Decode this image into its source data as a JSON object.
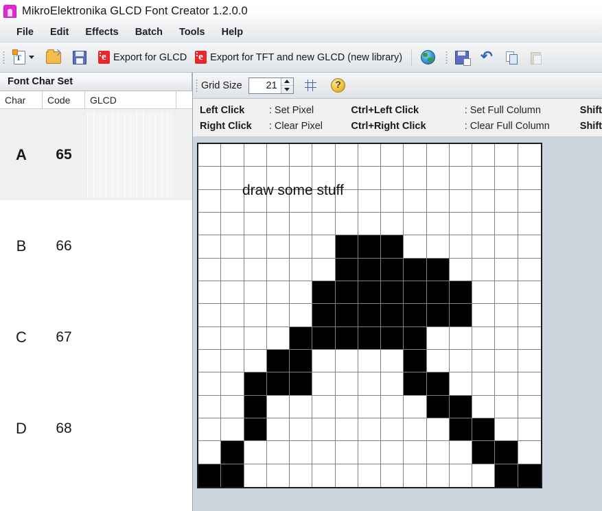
{
  "window": {
    "title": "MikroElektronika GLCD Font Creator 1.2.0.0",
    "icon": "app-icon"
  },
  "menubar": {
    "items": [
      {
        "label": "File"
      },
      {
        "label": "Edit"
      },
      {
        "label": "Effects"
      },
      {
        "label": "Batch"
      },
      {
        "label": "Tools"
      },
      {
        "label": "Help"
      }
    ]
  },
  "toolbar": {
    "new_label": "",
    "open_label": "",
    "save_label": "",
    "export_glcd_label": "Export for GLCD",
    "export_tft_label": "Export for TFT and new GLCD (new library)",
    "globe_label": "",
    "save_as_label": "",
    "undo_label": "",
    "copy_label": "",
    "paste_label": ""
  },
  "left_panel": {
    "header": "Font Char Set",
    "columns": [
      "Char",
      "Code",
      "GLCD"
    ],
    "rows": [
      {
        "char": "A",
        "code": "65",
        "selected": true,
        "has_preview": true
      },
      {
        "char": "B",
        "code": "66",
        "selected": false,
        "has_preview": false
      },
      {
        "char": "C",
        "code": "67",
        "selected": false,
        "has_preview": false
      },
      {
        "char": "D",
        "code": "68",
        "selected": false,
        "has_preview": false
      }
    ]
  },
  "grid_toolbar": {
    "grid_size_label": "Grid Size",
    "grid_size_value": "21",
    "toggle_grid_label": "",
    "help_label": ""
  },
  "legend": {
    "rows": [
      [
        {
          "key": "Left Click",
          "val": ": Set Pixel"
        },
        {
          "key": "Ctrl+Left Click",
          "val": ": Set Full Column"
        },
        {
          "key": "Shift",
          "val": ""
        }
      ],
      [
        {
          "key": "Right Click",
          "val": ": Clear Pixel"
        },
        {
          "key": "Ctrl+Right Click",
          "val": ": Clear Full Column"
        },
        {
          "key": "Shift",
          "val": ""
        }
      ]
    ]
  },
  "canvas": {
    "note": "draw some stuff",
    "cols": 15,
    "rows": 15,
    "on_color": "#000000",
    "off_color": "#ffffff",
    "grid_line_color": "#7d8288",
    "pixels": [
      [
        0,
        0,
        0,
        0,
        0,
        0,
        0,
        0,
        0,
        0,
        0,
        0,
        0,
        0,
        0
      ],
      [
        0,
        0,
        0,
        0,
        0,
        0,
        0,
        0,
        0,
        0,
        0,
        0,
        0,
        0,
        0
      ],
      [
        0,
        0,
        0,
        0,
        0,
        0,
        0,
        0,
        0,
        0,
        0,
        0,
        0,
        0,
        0
      ],
      [
        0,
        0,
        0,
        0,
        0,
        0,
        0,
        0,
        0,
        0,
        0,
        0,
        0,
        0,
        0
      ],
      [
        0,
        0,
        0,
        0,
        0,
        0,
        1,
        1,
        1,
        0,
        0,
        0,
        0,
        0,
        0
      ],
      [
        0,
        0,
        0,
        0,
        0,
        0,
        1,
        1,
        1,
        1,
        1,
        0,
        0,
        0,
        0
      ],
      [
        0,
        0,
        0,
        0,
        0,
        1,
        1,
        1,
        1,
        1,
        1,
        1,
        0,
        0,
        0
      ],
      [
        0,
        0,
        0,
        0,
        0,
        1,
        1,
        1,
        1,
        1,
        1,
        1,
        0,
        0,
        0
      ],
      [
        0,
        0,
        0,
        0,
        1,
        1,
        1,
        1,
        1,
        1,
        0,
        0,
        0,
        0,
        0
      ],
      [
        0,
        0,
        0,
        1,
        1,
        0,
        0,
        0,
        0,
        1,
        0,
        0,
        0,
        0,
        0
      ],
      [
        0,
        0,
        1,
        1,
        1,
        0,
        0,
        0,
        0,
        1,
        1,
        0,
        0,
        0,
        0
      ],
      [
        0,
        0,
        1,
        0,
        0,
        0,
        0,
        0,
        0,
        0,
        1,
        1,
        0,
        0,
        0
      ],
      [
        0,
        0,
        1,
        0,
        0,
        0,
        0,
        0,
        0,
        0,
        0,
        1,
        1,
        0,
        0
      ],
      [
        0,
        1,
        0,
        0,
        0,
        0,
        0,
        0,
        0,
        0,
        0,
        0,
        1,
        1,
        0
      ],
      [
        1,
        1,
        0,
        0,
        0,
        0,
        0,
        0,
        0,
        0,
        0,
        0,
        0,
        1,
        1
      ]
    ]
  },
  "colors": {
    "window_bg": "#ccd4de",
    "panel_bg": "#ffffff",
    "accent_red": "#e8262e",
    "title_icon": "#e12bd0",
    "legend_bg": "#f1f1f1",
    "selection": "#f0f0f0"
  }
}
